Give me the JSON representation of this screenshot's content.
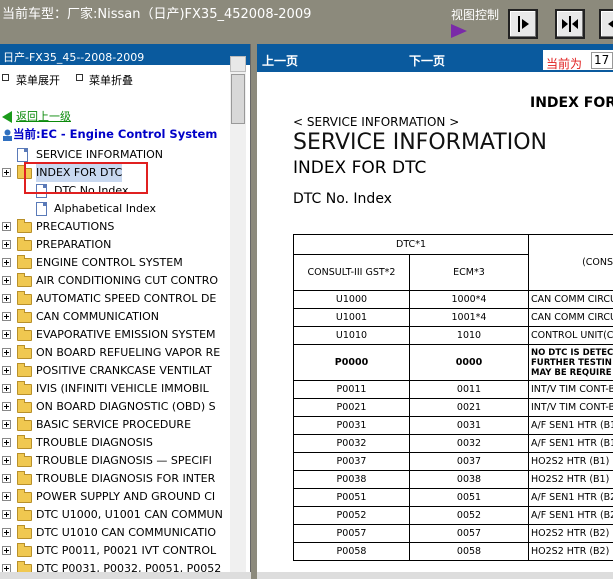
{
  "top": {
    "car_title": "当前车型：厂家:Nissan（日产)FX35_452008-2009",
    "view_control": "视图控制"
  },
  "left": {
    "header": "日产-FX35_45--2008-2009",
    "expand": "菜单展开",
    "collapse": "菜单折叠",
    "back": "返回上一级",
    "current": "当前:EC - Engine Control System",
    "tree": [
      {
        "label": "SERVICE INFORMATION",
        "type": "doc",
        "level": 1
      },
      {
        "label": "INDEX FOR DTC",
        "type": "folder-open",
        "level": 0,
        "selected": true
      },
      {
        "label": "DTC No Index",
        "type": "doc",
        "level": 2
      },
      {
        "label": "Alphabetical Index",
        "type": "doc",
        "level": 2
      },
      {
        "label": "PRECAUTIONS",
        "type": "folder",
        "level": 0
      },
      {
        "label": "PREPARATION",
        "type": "folder",
        "level": 0
      },
      {
        "label": "ENGINE CONTROL SYSTEM",
        "type": "folder",
        "level": 0
      },
      {
        "label": "AIR CONDITIONING CUT CONTRO",
        "type": "folder",
        "level": 0
      },
      {
        "label": "AUTOMATIC SPEED CONTROL DE",
        "type": "folder",
        "level": 0
      },
      {
        "label": "CAN COMMUNICATION",
        "type": "folder",
        "level": 0
      },
      {
        "label": "EVAPORATIVE EMISSION SYSTEM",
        "type": "folder",
        "level": 0
      },
      {
        "label": "ON BOARD REFUELING VAPOR RE",
        "type": "folder",
        "level": 0
      },
      {
        "label": "POSITIVE CRANKCASE VENTILAT",
        "type": "folder",
        "level": 0
      },
      {
        "label": "IVIS (INFINITI VEHICLE IMMOBIL",
        "type": "folder",
        "level": 0
      },
      {
        "label": "ON BOARD DIAGNOSTIC (OBD) S",
        "type": "folder",
        "level": 0
      },
      {
        "label": "BASIC SERVICE PROCEDURE",
        "type": "folder",
        "level": 0
      },
      {
        "label": "TROUBLE DIAGNOSIS",
        "type": "folder",
        "level": 0
      },
      {
        "label": "TROUBLE DIAGNOSIS — SPECIFI",
        "type": "folder",
        "level": 0
      },
      {
        "label": "TROUBLE DIAGNOSIS FOR INTER",
        "type": "folder",
        "level": 0
      },
      {
        "label": "POWER SUPPLY AND GROUND CI",
        "type": "folder",
        "level": 0
      },
      {
        "label": "DTC U1000, U1001 CAN COMMUN",
        "type": "folder",
        "level": 0
      },
      {
        "label": "DTC U1010 CAN COMMUNICATIO",
        "type": "folder",
        "level": 0
      },
      {
        "label": "DTC P0011, P0021 IVT CONTROL",
        "type": "folder",
        "level": 0
      },
      {
        "label": "DTC P0031, P0032, P0051, P0052",
        "type": "folder",
        "level": 0
      }
    ]
  },
  "right": {
    "prev": "上一页",
    "next": "下一页",
    "current_label": "当前为",
    "page": "17",
    "doc_header": "INDEX FOR",
    "svc_small": "< SERVICE INFORMATION >",
    "svc_big": "SERVICE INFORMATION",
    "index_dtc": "INDEX FOR DTC",
    "dtc_no_index": "DTC No. Index",
    "table": {
      "dtc_header": "DTC*1",
      "consult_header": "CONSULT-III GST*2",
      "ecm_header": "ECM*3",
      "consult_right": "(CONSU",
      "rows": [
        [
          "U1000",
          "1000*4",
          "CAN COMM CIRCU"
        ],
        [
          "U1001",
          "1001*4",
          "CAN COMM CIRCU"
        ],
        [
          "U1010",
          "1010",
          "CONTROL UNIT(CA"
        ],
        [
          "P0000",
          "0000",
          "NO DTC IS DETEC FURTHER TESTIN MAY BE REQUIRE"
        ],
        [
          "P0011",
          "0011",
          "INT/V TIM CONT-B"
        ],
        [
          "P0021",
          "0021",
          "INT/V TIM CONT-B"
        ],
        [
          "P0031",
          "0031",
          "A/F SEN1 HTR (B1"
        ],
        [
          "P0032",
          "0032",
          "A/F SEN1 HTR (B1"
        ],
        [
          "P0037",
          "0037",
          "HO2S2 HTR (B1)"
        ],
        [
          "P0038",
          "0038",
          "HO2S2 HTR (B1)"
        ],
        [
          "P0051",
          "0051",
          "A/F SEN1 HTR (B2"
        ],
        [
          "P0052",
          "0052",
          "A/F SEN1 HTR (B2"
        ],
        [
          "P0057",
          "0057",
          "HO2S2 HTR (B2)"
        ],
        [
          "P0058",
          "0058",
          "HO2S2 HTR (B2)"
        ]
      ]
    }
  }
}
